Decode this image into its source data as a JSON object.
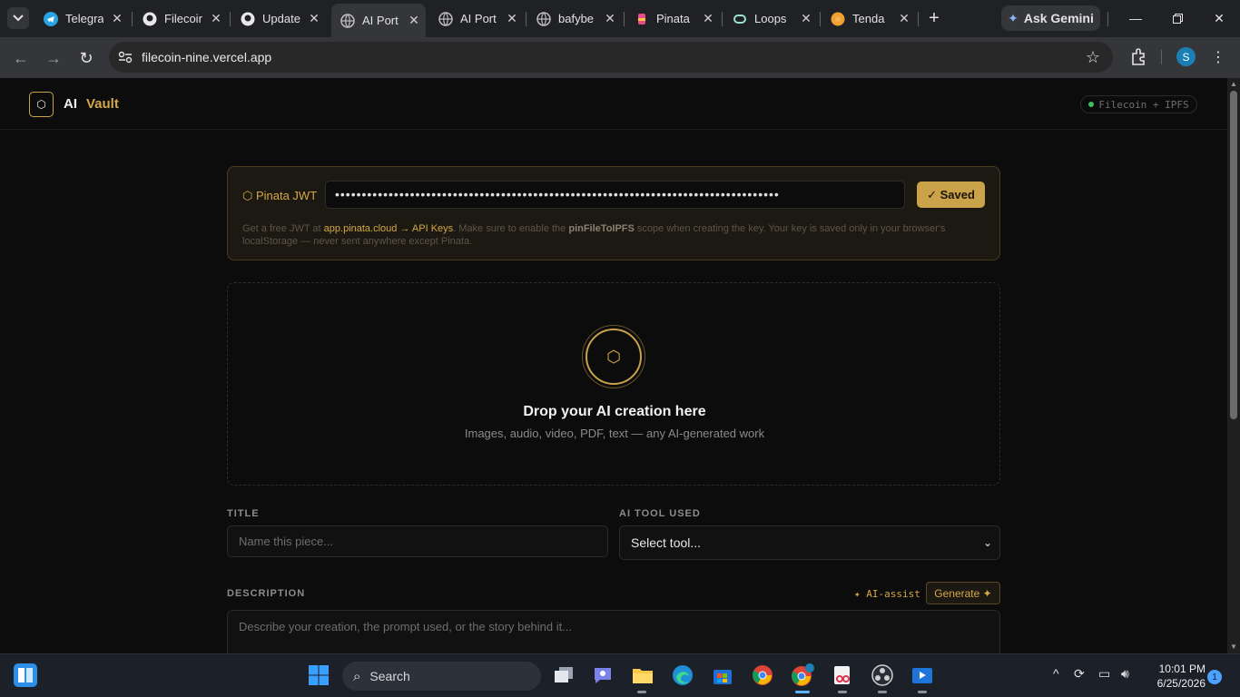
{
  "browser": {
    "tabs": [
      {
        "label": "Telegra",
        "icon": "telegram-icon"
      },
      {
        "label": "Filecoir",
        "icon": "github-icon"
      },
      {
        "label": "Update",
        "icon": "github-icon"
      },
      {
        "label": "AI Port",
        "icon": "globe-icon",
        "active": true
      },
      {
        "label": "AI Port",
        "icon": "globe-icon"
      },
      {
        "label": "bafybe",
        "icon": "globe-icon"
      },
      {
        "label": "Pinata",
        "icon": "pinata-icon"
      },
      {
        "label": "Loops",
        "icon": "loops-icon"
      },
      {
        "label": "Tenda",
        "icon": "tenda-icon"
      }
    ],
    "ask_gemini": "Ask Gemini",
    "url": "filecoin-nine.vercel.app",
    "profile_initial": "S"
  },
  "header": {
    "logo_ai": "AI",
    "logo_vault": "Vault",
    "network_badge": "Filecoin + IPFS"
  },
  "jwt": {
    "label": "⬡ Pinata JWT",
    "masked_value": "•••••••••••••••••••••••••••••••••••••••••••••••••••••••••••••••••••••••••••••••••••",
    "saved_button": "✓ Saved",
    "help_pre": "Get a free JWT at ",
    "help_link": "app.pinata.cloud → API Keys",
    "help_mid": ". Make sure to enable the ",
    "help_scope": "pinFileToIPFS",
    "help_post": " scope when creating the key. Your key is saved only in your browser's localStorage — never sent anywhere except Pinata."
  },
  "dropzone": {
    "icon": "⬡",
    "title": "Drop your AI creation here",
    "subtitle": "Images, audio, video, PDF, text — any AI-generated work"
  },
  "form": {
    "title_label": "TITLE",
    "title_placeholder": "Name this piece...",
    "tool_label": "AI TOOL USED",
    "tool_selected": "Select tool...",
    "description_label": "DESCRIPTION",
    "ai_assist": "✦ AI-assist",
    "generate_button": "Generate ✦",
    "description_placeholder": "Describe your creation, the prompt used, or the story behind it..."
  },
  "taskbar": {
    "search": "Search",
    "time": "10:01 PM",
    "date": "6/25/2026",
    "notifications": "1"
  },
  "colors": {
    "accent": "#c9a24a",
    "page_bg": "#0c0c0d"
  }
}
